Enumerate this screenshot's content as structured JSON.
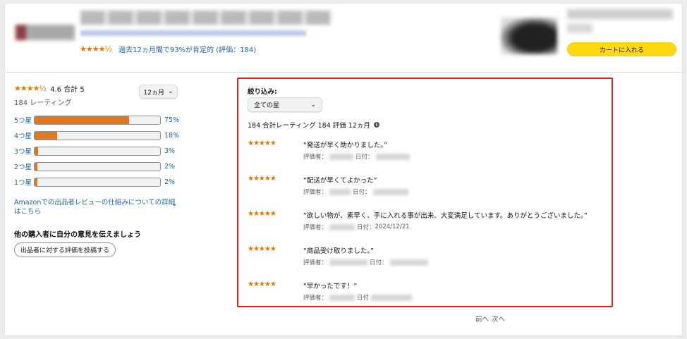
{
  "header": {
    "rating_stars": "★★★★½",
    "positive_text": "過去12ヵ月間で93%が肯定的",
    "positive_pct": "93%",
    "rating_count_text": "(評価：184)",
    "cart_button": "カートに入れる"
  },
  "summary": {
    "stars": "★★★★½",
    "rating": "4.6 合計 5",
    "count": "184 レーティング",
    "period": "12ヵ月",
    "histogram": [
      {
        "label": "5つ星",
        "pct_text": "75%",
        "value": 75
      },
      {
        "label": "4つ星",
        "pct_text": "18%",
        "value": 18
      },
      {
        "label": "3つ星",
        "pct_text": "3%",
        "value": 3
      },
      {
        "label": "2つ星",
        "pct_text": "2%",
        "value": 2
      },
      {
        "label": "1つ星",
        "pct_text": "2%",
        "value": 2
      }
    ],
    "how_link": "Amazonでの出品者レビューの仕組みについての詳細はこちら",
    "tell_heading": "他の購入者に自分の意見を伝えましょう",
    "post_button": "出品者に対する評価を投稿する"
  },
  "filter": {
    "label": "絞り込み:",
    "select_value": "全ての星",
    "summary": "184 合計レーティング 184 評価 12ヵ月"
  },
  "reviews": [
    {
      "stars": "★★★★★",
      "text": "“発送が早く助かりました。”",
      "reviewer_label": "評価者：",
      "date_label": "日付：",
      "date": ""
    },
    {
      "stars": "★★★★★",
      "text": "“配送が早くてよかった”",
      "reviewer_label": "評価者：",
      "date_label": "日付：",
      "date": ""
    },
    {
      "stars": "★★★★★",
      "text": "“欲しい物が、素早く、手に入れる事が出来、大変満足しています。ありがとうございました。”",
      "reviewer_label": "評価者：",
      "date_label": "日付：",
      "date": "2024/12/21"
    },
    {
      "stars": "★★★★★",
      "text": "“商品受け取りました。”",
      "reviewer_label": "評価者：",
      "date_label": "日付：",
      "date": ""
    },
    {
      "stars": "★★★★★",
      "text": "“早かったです！”",
      "reviewer_label": "評価者：",
      "date_label": "日付",
      "date": ""
    }
  ],
  "pager": {
    "prev": "前へ",
    "next": "次へ"
  },
  "colors": {
    "star": "#e77600",
    "bar_fill": "#de7921",
    "link": "#2162a1",
    "highlight_border": "#e2231a",
    "cart_button": "#ffd814"
  }
}
